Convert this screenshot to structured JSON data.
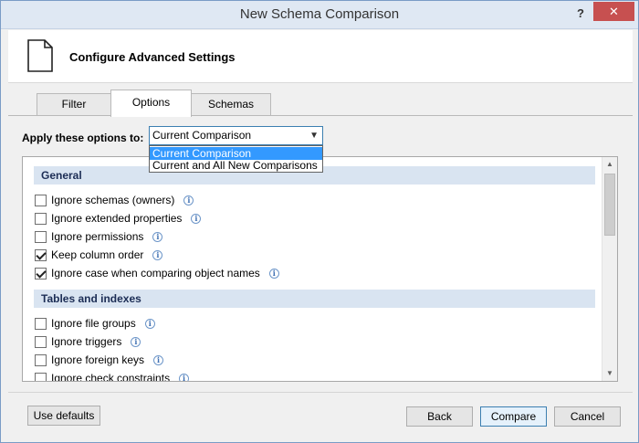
{
  "window": {
    "title": "New Schema Comparison",
    "help": "?",
    "close": "✕"
  },
  "header": {
    "title": "Configure Advanced Settings"
  },
  "tabs": [
    {
      "label": "Filter"
    },
    {
      "label": "Options"
    },
    {
      "label": "Schemas"
    }
  ],
  "options_panel": {
    "apply_label": "Apply these options to:",
    "combo": {
      "value": "Current Comparison",
      "options": [
        "Current Comparison",
        "Current and All New Comparisons"
      ]
    }
  },
  "sections": [
    {
      "title": "General",
      "items": [
        {
          "label": "Ignore schemas (owners)",
          "checked": false
        },
        {
          "label": "Ignore extended properties",
          "checked": false
        },
        {
          "label": "Ignore permissions",
          "checked": false
        },
        {
          "label": "Keep column order",
          "checked": true
        },
        {
          "label": "Ignore case when comparing object names",
          "checked": true
        }
      ]
    },
    {
      "title": "Tables and indexes",
      "items": [
        {
          "label": "Ignore file groups",
          "checked": false
        },
        {
          "label": "Ignore triggers",
          "checked": false
        },
        {
          "label": "Ignore foreign keys",
          "checked": false
        },
        {
          "label": "Ignore check constraints",
          "checked": false
        }
      ]
    }
  ],
  "footer": {
    "use_defaults": "Use defaults",
    "back": "Back",
    "compare": "Compare",
    "cancel": "Cancel"
  },
  "colors": {
    "accent": "#3399ff",
    "section_bg": "#d9e4f1",
    "close_bg": "#c75050"
  }
}
